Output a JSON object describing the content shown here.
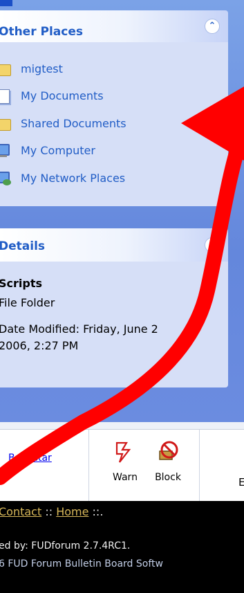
{
  "other_places": {
    "title": "Other Places",
    "items": [
      "migtest",
      "My Documents",
      "Shared Documents",
      "My Computer",
      "My Network Places"
    ],
    "icons": [
      "folder-icon",
      "documents-icon",
      "folder-icon",
      "computer-icon",
      "network-places-icon"
    ]
  },
  "details": {
    "title": "Details",
    "name": "Scripts",
    "type": "File Folder",
    "date_line1": "Date Modified: Friday, June 2",
    "date_line2": "2006, 2:27 PM"
  },
  "toolbar": {
    "link_text": "Be a star",
    "warn_label": "Warn",
    "block_label": "Block",
    "cut_label": "E"
  },
  "footer": {
    "contact": "Contact",
    "sep1": " :: ",
    "home": "Home",
    "sep2": " ::.",
    "powered": "ed by: FUDforum 2.7.4RC1.",
    "copyright": "6 FUD Forum Bulletin Board Softw"
  },
  "colors": {
    "accent": "#215dc6",
    "pane_bg": "#6b8ce0",
    "box_bg": "#d6dff7",
    "annotation_red": "#ff0000",
    "footer_link": "#d8b85a"
  }
}
